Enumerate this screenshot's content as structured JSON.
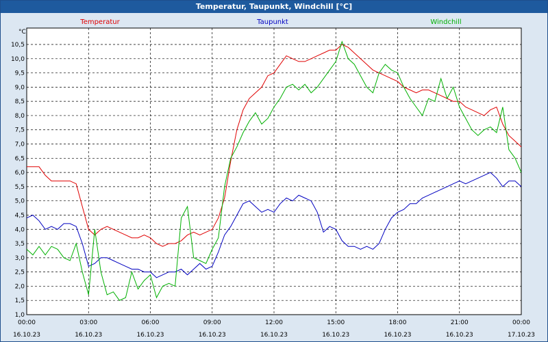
{
  "window": {
    "title": "Temperatur, Taupunkt, Windchill [°C]"
  },
  "chart_data": {
    "type": "line",
    "title": "Temperatur, Taupunkt, Windchill [°C]",
    "ylabel": "°C",
    "ylim": [
      1.0,
      11.0
    ],
    "yticks": [
      "1,0",
      "1,5",
      "2,0",
      "2,5",
      "3,0",
      "3,5",
      "4,0",
      "4,5",
      "5,0",
      "5,5",
      "6,0",
      "6,5",
      "7,0",
      "7,5",
      "8,0",
      "8,5",
      "9,0",
      "9,5",
      "10,0",
      "10,5"
    ],
    "xlim": [
      0,
      24
    ],
    "xticks": [
      {
        "time": "00:00",
        "date": "16.10.23",
        "h": 0
      },
      {
        "time": "03:00",
        "date": "16.10.23",
        "h": 3
      },
      {
        "time": "06:00",
        "date": "16.10.23",
        "h": 6
      },
      {
        "time": "09:00",
        "date": "16.10.23",
        "h": 9
      },
      {
        "time": "12:00",
        "date": "16.10.23",
        "h": 12
      },
      {
        "time": "15:00",
        "date": "16.10.23",
        "h": 15
      },
      {
        "time": "18:00",
        "date": "16.10.23",
        "h": 18
      },
      {
        "time": "21:00",
        "date": "16.10.23",
        "h": 21
      },
      {
        "time": "00:00",
        "date": "17.10.23",
        "h": 24
      }
    ],
    "grid": true,
    "legend_position": "top",
    "series": [
      {
        "name": "Temperatur",
        "color": "#e00000",
        "x": [
          0,
          0.3,
          0.6,
          0.9,
          1.2,
          1.5,
          1.8,
          2.1,
          2.4,
          2.7,
          3.0,
          3.3,
          3.6,
          3.9,
          4.2,
          4.5,
          4.8,
          5.1,
          5.4,
          5.7,
          6.0,
          6.3,
          6.6,
          6.9,
          7.2,
          7.5,
          7.8,
          8.1,
          8.4,
          8.7,
          9.0,
          9.3,
          9.6,
          9.9,
          10.2,
          10.5,
          10.8,
          11.1,
          11.4,
          11.7,
          12.0,
          12.3,
          12.6,
          12.9,
          13.2,
          13.5,
          13.8,
          14.1,
          14.4,
          14.7,
          15.0,
          15.3,
          15.6,
          15.9,
          16.2,
          16.5,
          16.8,
          17.1,
          17.4,
          17.7,
          18.0,
          18.3,
          18.6,
          18.9,
          19.2,
          19.5,
          19.8,
          20.1,
          20.4,
          20.7,
          21.0,
          21.3,
          21.6,
          21.9,
          22.2,
          22.5,
          22.8,
          23.1,
          23.4,
          23.7,
          24.0
        ],
        "values": [
          6.2,
          6.2,
          6.2,
          5.9,
          5.7,
          5.7,
          5.7,
          5.7,
          5.6,
          4.8,
          4.0,
          3.8,
          4.0,
          4.1,
          4.0,
          3.9,
          3.8,
          3.7,
          3.7,
          3.8,
          3.7,
          3.5,
          3.4,
          3.5,
          3.5,
          3.6,
          3.8,
          3.9,
          3.8,
          3.9,
          4.0,
          4.4,
          5.1,
          6.4,
          7.5,
          8.2,
          8.6,
          8.8,
          9.0,
          9.4,
          9.5,
          9.8,
          10.1,
          10.0,
          9.9,
          9.9,
          10.0,
          10.1,
          10.2,
          10.3,
          10.3,
          10.5,
          10.4,
          10.2,
          10.0,
          9.8,
          9.6,
          9.5,
          9.4,
          9.3,
          9.2,
          9.0,
          8.9,
          8.8,
          8.9,
          8.9,
          8.8,
          8.7,
          8.6,
          8.5,
          8.5,
          8.3,
          8.2,
          8.1,
          8.0,
          8.2,
          8.3,
          7.7,
          7.3,
          7.1,
          6.9
        ]
      },
      {
        "name": "Taupunkt",
        "color": "#0000c0",
        "x": [
          0,
          0.3,
          0.6,
          0.9,
          1.2,
          1.5,
          1.8,
          2.1,
          2.4,
          2.7,
          3.0,
          3.3,
          3.6,
          3.9,
          4.2,
          4.5,
          4.8,
          5.1,
          5.4,
          5.7,
          6.0,
          6.3,
          6.6,
          6.9,
          7.2,
          7.5,
          7.8,
          8.1,
          8.4,
          8.7,
          9.0,
          9.3,
          9.6,
          9.9,
          10.2,
          10.5,
          10.8,
          11.1,
          11.4,
          11.7,
          12.0,
          12.3,
          12.6,
          12.9,
          13.2,
          13.5,
          13.8,
          14.1,
          14.4,
          14.7,
          15.0,
          15.3,
          15.6,
          15.9,
          16.2,
          16.5,
          16.8,
          17.1,
          17.4,
          17.7,
          18.0,
          18.3,
          18.6,
          18.9,
          19.2,
          19.5,
          19.8,
          20.1,
          20.4,
          20.7,
          21.0,
          21.3,
          21.6,
          21.9,
          22.2,
          22.5,
          22.8,
          23.1,
          23.4,
          23.7,
          24.0
        ],
        "values": [
          4.4,
          4.5,
          4.3,
          4.0,
          4.1,
          4.0,
          4.2,
          4.2,
          4.1,
          3.5,
          2.7,
          2.8,
          3.0,
          3.0,
          2.9,
          2.8,
          2.7,
          2.6,
          2.6,
          2.5,
          2.5,
          2.3,
          2.4,
          2.5,
          2.5,
          2.6,
          2.4,
          2.6,
          2.8,
          2.6,
          2.7,
          3.2,
          3.8,
          4.1,
          4.5,
          4.9,
          5.0,
          4.8,
          4.6,
          4.7,
          4.6,
          4.9,
          5.1,
          5.0,
          5.2,
          5.1,
          5.0,
          4.6,
          3.9,
          4.1,
          4.0,
          3.6,
          3.4,
          3.4,
          3.3,
          3.4,
          3.3,
          3.5,
          4.0,
          4.4,
          4.6,
          4.7,
          4.9,
          4.9,
          5.1,
          5.2,
          5.3,
          5.4,
          5.5,
          5.6,
          5.7,
          5.6,
          5.7,
          5.8,
          5.9,
          6.0,
          5.8,
          5.5,
          5.7,
          5.7,
          5.5
        ]
      },
      {
        "name": "Windchill",
        "color": "#00b000",
        "x": [
          0,
          0.3,
          0.6,
          0.9,
          1.2,
          1.5,
          1.8,
          2.1,
          2.4,
          2.7,
          3.0,
          3.3,
          3.6,
          3.9,
          4.2,
          4.5,
          4.8,
          5.1,
          5.4,
          5.7,
          6.0,
          6.3,
          6.6,
          6.9,
          7.2,
          7.5,
          7.8,
          8.1,
          8.4,
          8.7,
          9.0,
          9.3,
          9.6,
          9.9,
          10.2,
          10.5,
          10.8,
          11.1,
          11.4,
          11.7,
          12.0,
          12.3,
          12.6,
          12.9,
          13.2,
          13.5,
          13.8,
          14.1,
          14.4,
          14.7,
          15.0,
          15.3,
          15.6,
          15.9,
          16.2,
          16.5,
          16.8,
          17.1,
          17.4,
          17.7,
          18.0,
          18.3,
          18.6,
          18.9,
          19.2,
          19.5,
          19.8,
          20.1,
          20.4,
          20.7,
          21.0,
          21.3,
          21.6,
          21.9,
          22.2,
          22.5,
          22.8,
          23.1,
          23.4,
          23.7,
          24.0
        ],
        "values": [
          3.3,
          3.1,
          3.4,
          3.1,
          3.4,
          3.3,
          3.0,
          2.9,
          3.5,
          2.5,
          1.7,
          4.0,
          2.5,
          1.7,
          1.8,
          1.5,
          1.6,
          2.5,
          1.9,
          2.2,
          2.4,
          1.6,
          2.0,
          2.1,
          2.0,
          4.4,
          4.8,
          3.0,
          2.9,
          2.8,
          3.3,
          3.7,
          5.5,
          6.5,
          6.9,
          7.4,
          7.8,
          8.1,
          7.7,
          7.9,
          8.3,
          8.6,
          9.0,
          9.1,
          8.9,
          9.1,
          8.8,
          9.0,
          9.3,
          9.6,
          9.9,
          10.6,
          10.0,
          9.8,
          9.4,
          9.0,
          8.8,
          9.5,
          9.8,
          9.6,
          9.5,
          9.0,
          8.6,
          8.3,
          8.0,
          8.6,
          8.5,
          9.3,
          8.6,
          9.0,
          8.3,
          7.9,
          7.5,
          7.3,
          7.5,
          7.6,
          7.4,
          8.3,
          6.8,
          6.5,
          6.0
        ]
      }
    ]
  }
}
